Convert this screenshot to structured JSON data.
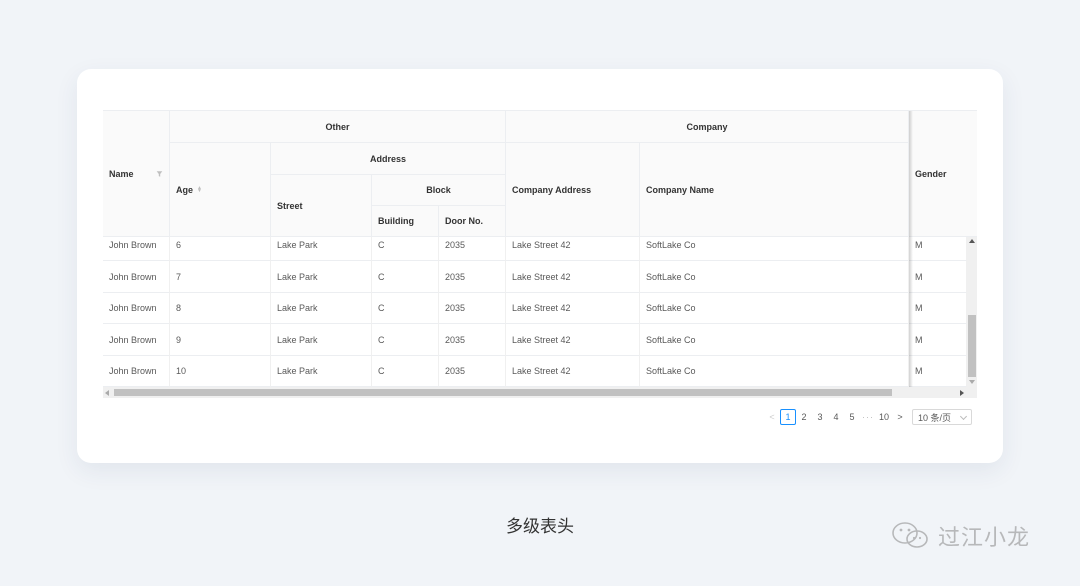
{
  "table": {
    "headers": {
      "name": "Name",
      "other": "Other",
      "age": "Age",
      "address": "Address",
      "street": "Street",
      "block": "Block",
      "building": "Building",
      "door_no": "Door No.",
      "company": "Company",
      "company_address": "Company Address",
      "company_name": "Company Name",
      "gender": "Gender"
    },
    "rows": [
      {
        "name": "John Brown",
        "age": "6",
        "street": "Lake Park",
        "building": "C",
        "door_no": "2035",
        "company_address": "Lake Street 42",
        "company_name": "SoftLake Co",
        "gender": "M"
      },
      {
        "name": "John Brown",
        "age": "7",
        "street": "Lake Park",
        "building": "C",
        "door_no": "2035",
        "company_address": "Lake Street 42",
        "company_name": "SoftLake Co",
        "gender": "M"
      },
      {
        "name": "John Brown",
        "age": "8",
        "street": "Lake Park",
        "building": "C",
        "door_no": "2035",
        "company_address": "Lake Street 42",
        "company_name": "SoftLake Co",
        "gender": "M"
      },
      {
        "name": "John Brown",
        "age": "9",
        "street": "Lake Park",
        "building": "C",
        "door_no": "2035",
        "company_address": "Lake Street 42",
        "company_name": "SoftLake Co",
        "gender": "M"
      },
      {
        "name": "John Brown",
        "age": "10",
        "street": "Lake Park",
        "building": "C",
        "door_no": "2035",
        "company_address": "Lake Street 42",
        "company_name": "SoftLake Co",
        "gender": "M"
      }
    ]
  },
  "pagination": {
    "prev": "<",
    "pages": [
      "1",
      "2",
      "3",
      "4",
      "5"
    ],
    "active_page": "1",
    "ellipsis": "···",
    "last": "10",
    "next": ">",
    "page_size": "10 条/页"
  },
  "caption": "多级表头",
  "watermark": "过江小龙",
  "colors": {
    "accent": "#1890ff",
    "background": "#f1f4f8",
    "header_bg": "#fafafa"
  }
}
